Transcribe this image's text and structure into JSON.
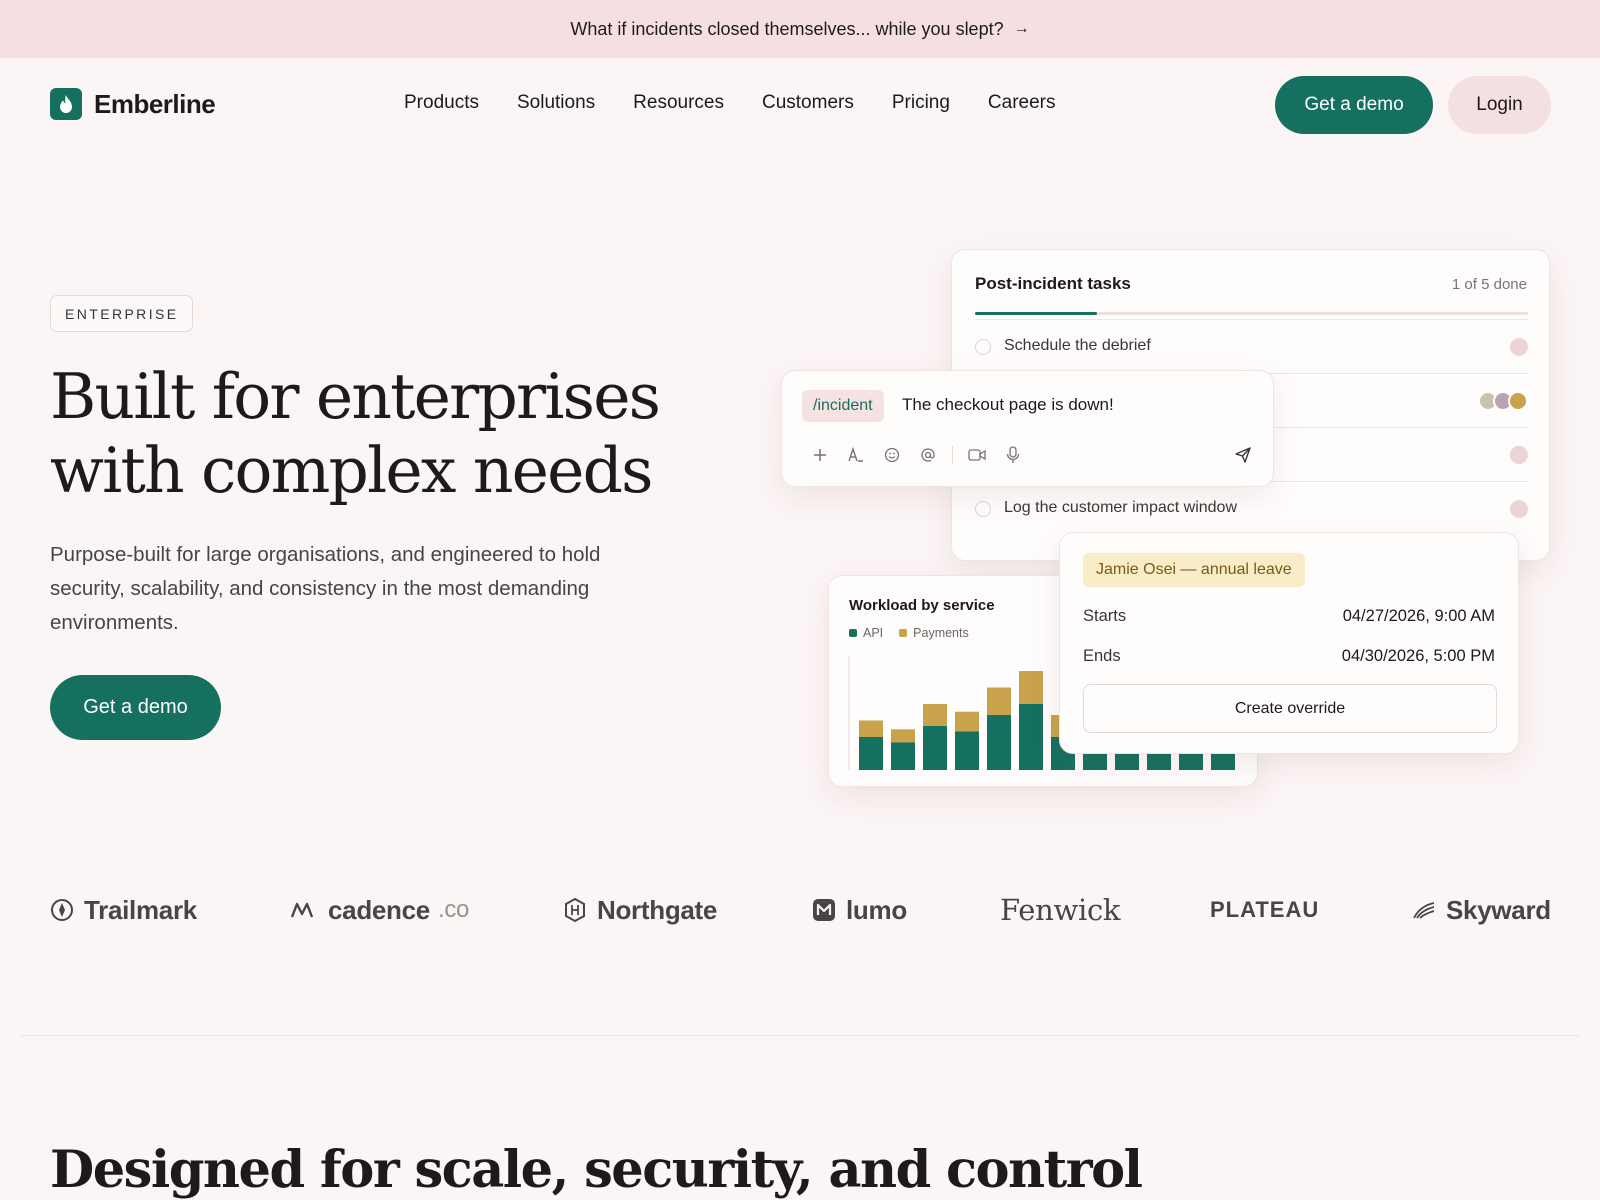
{
  "banner": {
    "text": "What if incidents closed themselves... while you slept?",
    "arrow": "→"
  },
  "brand": {
    "name": "Emberline",
    "accent": "#16705f"
  },
  "nav": {
    "items": [
      "Products",
      "Solutions",
      "Resources",
      "Customers",
      "Pricing",
      "Careers"
    ],
    "demo_label": "Get a demo",
    "login_label": "Login"
  },
  "hero": {
    "eyebrow": "ENTERPRISE",
    "title_line1": "Built for enterprises",
    "title_line2": "with complex needs",
    "subtitle": "Purpose-built for large organisations, and engineered to hold security, scalability, and consistency in the most demanding environments.",
    "cta_label": "Get a demo"
  },
  "tasks_card": {
    "title": "Post-incident tasks",
    "count": "1 of 5 done",
    "progress": 0.22,
    "tasks": [
      {
        "label": "Schedule the debrief"
      },
      {
        "label": ""
      },
      {
        "label": ""
      },
      {
        "label": "Log the customer impact window"
      }
    ]
  },
  "composer": {
    "tag": "/incident",
    "message": "The checkout page is down!",
    "tools": [
      "plus-icon",
      "text-format-icon",
      "emoji-icon",
      "mention-icon",
      "video-icon",
      "mic-icon"
    ],
    "send_icon": "send-icon"
  },
  "workload": {
    "title": "Workload by service",
    "legend": [
      "API",
      "Payments"
    ],
    "colors": {
      "api": "#16705f",
      "payments": "#c9a24c"
    }
  },
  "chart_data": {
    "type": "bar",
    "title": "Workload by service",
    "series": [
      {
        "name": "API",
        "values": [
          3,
          2.5,
          4,
          3.5,
          5,
          6,
          3,
          2,
          1.5,
          1.5,
          2,
          1.5
        ]
      },
      {
        "name": "Payments",
        "values": [
          1.5,
          1.2,
          2,
          1.8,
          2.5,
          3,
          2,
          1,
          1,
          1,
          1,
          1
        ]
      }
    ],
    "stacked": true,
    "ylim": [
      0,
      10
    ],
    "grid": false
  },
  "leave_card": {
    "tag": "Jamie Osei — annual leave",
    "starts_label": "Starts",
    "starts_value": "04/27/2026, 9:00 AM",
    "ends_label": "Ends",
    "ends_value": "04/30/2026, 5:00 PM",
    "button_label": "Create override"
  },
  "logos": {
    "trailmark": "Trailmark",
    "cadence": "cadence",
    "cadence_suffix": ".co",
    "northgate": "Northgate",
    "lumo": "lumo",
    "fenwick": "Fenwick",
    "plateau": "PLATEAU",
    "skyward": "Skyward"
  },
  "section2": {
    "title": "Designed for scale, security, and control"
  }
}
